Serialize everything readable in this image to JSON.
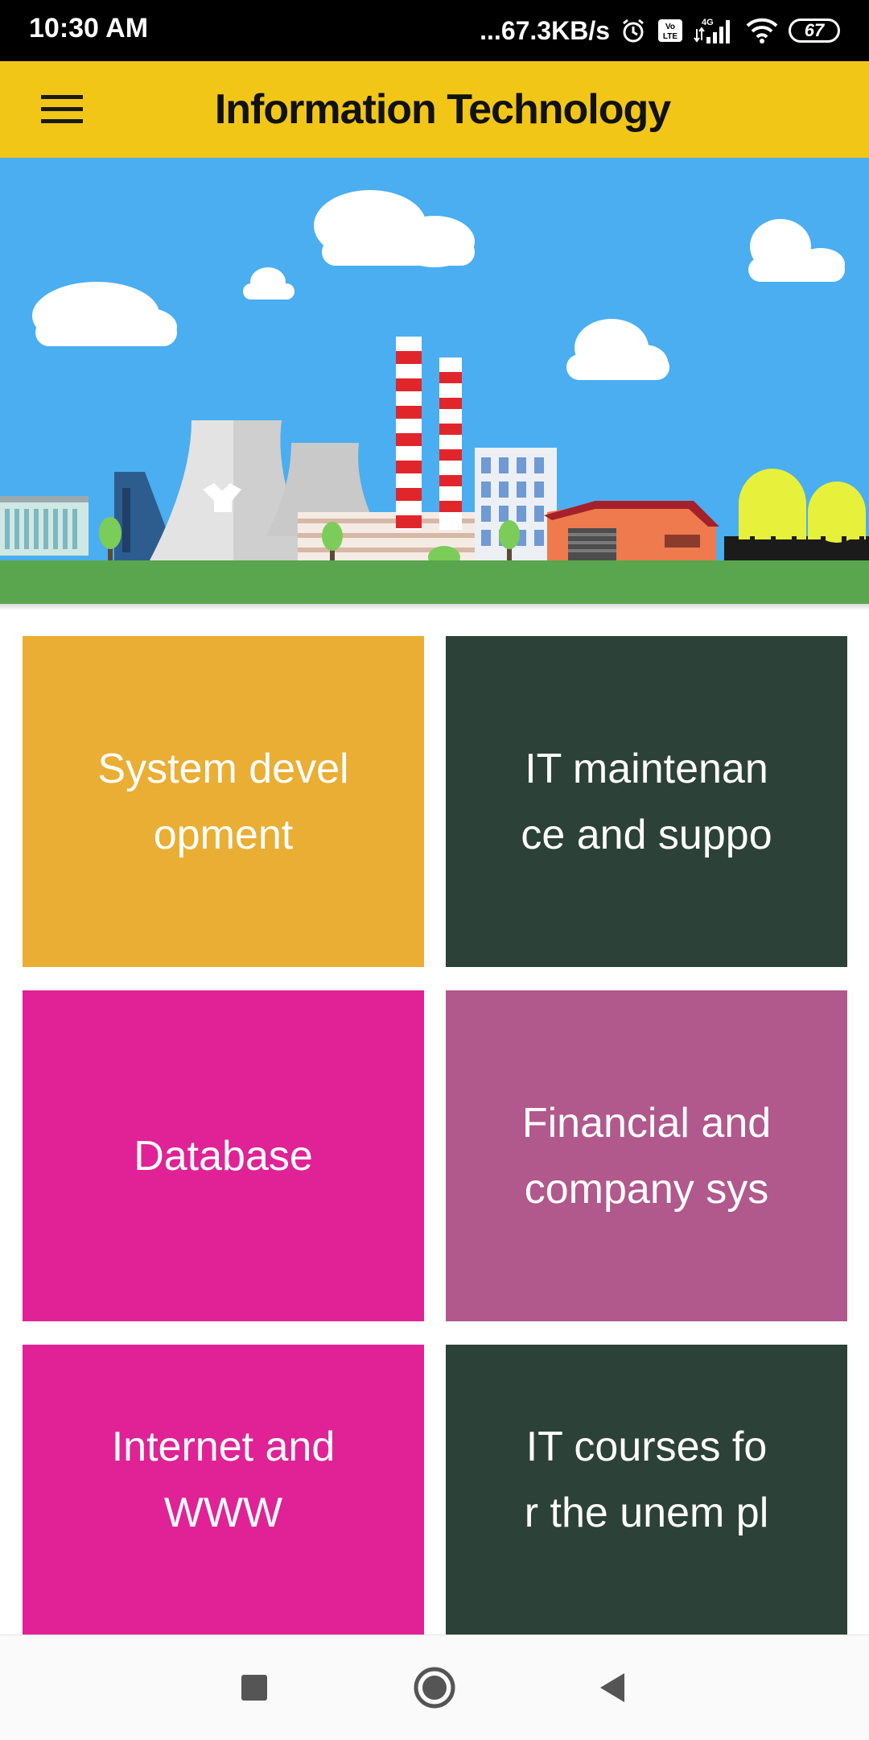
{
  "status_bar": {
    "time": "10:30 AM",
    "network_speed": "...67.3KB/s",
    "volte_label": "VoLTE",
    "network_type": "4G",
    "battery": "67",
    "icons": [
      "alarm-icon",
      "volte-icon",
      "signal-icon",
      "wifi-icon",
      "battery-icon"
    ]
  },
  "app_bar": {
    "title": "Information Technology",
    "menu_icon": "hamburger-menu-icon",
    "background": "#f1c617"
  },
  "banner": {
    "description_icon": "industrial-city-illustration",
    "sky_color": "#4aaef0",
    "ground_color": "#5aa64e"
  },
  "tiles": [
    {
      "label": "System devel\nopment",
      "color": "#e9ae33"
    },
    {
      "label": "IT maintenan\nce and suppo",
      "color": "#2c4137"
    },
    {
      "label": "Database",
      "color": "#e02296"
    },
    {
      "label": "Financial and\ncompany sys",
      "color": "#b1588c"
    },
    {
      "label": "Internet and\nWWW",
      "color": "#e02296"
    },
    {
      "label": "IT courses fo\nr the unem pl",
      "color": "#2c4137"
    }
  ],
  "nav_bar": {
    "icons": [
      "recent-apps-icon",
      "home-icon",
      "back-icon"
    ]
  }
}
